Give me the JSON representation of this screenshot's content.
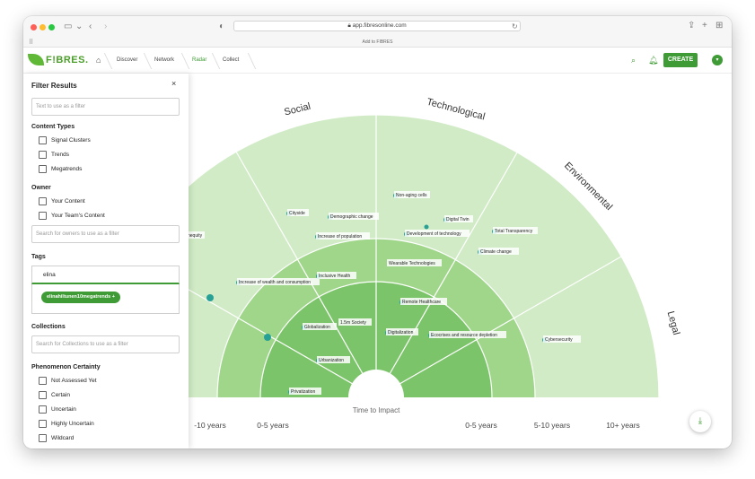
{
  "browser": {
    "url": "app.fibresonline.com",
    "add_to": "Add to FIBRES",
    "lights": [
      "#fe5f57",
      "#febc2e",
      "#28c840"
    ]
  },
  "nav": {
    "logo": "F!BRES.",
    "crumbs": [
      "Discover",
      "Network",
      "Radar",
      "Collect"
    ],
    "active": "Radar",
    "create_label": "CREATE",
    "accent": "#3f9b35"
  },
  "filter": {
    "title": "Filter Results",
    "close": "×",
    "search_placeholder": "Text to use as a filter",
    "content_types_label": "Content Types",
    "content_types": [
      "Signal Clusters",
      "Trends",
      "Megatrends"
    ],
    "owner_label": "Owner",
    "owner_options": [
      "Your Content",
      "Your Team's Content"
    ],
    "owner_placeholder": "Search for owners to use as a filter",
    "tags_label": "Tags",
    "tag_input_value": "elina",
    "tag_chip": "elinahiltunen10megatrends +",
    "collections_label": "Collections",
    "collections_placeholder": "Search for Collections to use as a filter",
    "certainty_label": "Phenomenon Certainty",
    "certainty_options": [
      "Not Assessed Yet",
      "Certain",
      "Uncertain",
      "Highly Uncertain",
      "Wildcard"
    ]
  },
  "radar": {
    "sectors": [
      "Social",
      "Technological",
      "Environmental",
      "Legal"
    ],
    "center_label": "Time to Impact",
    "axis_labels": [
      "-10 years",
      "0-5 years",
      "0-5 years",
      "5-10 years",
      "10+ years"
    ],
    "items": [
      "Non-aging cells",
      "Cityside",
      "Demographic change",
      "Digital Twin",
      "Development of technology",
      "Total Transparency",
      "Increase of population",
      "nequity",
      "Climate change",
      "Wearable Technologies",
      "Increase of wealth and consumption",
      "Inclusive Health",
      "Remote Healthcare",
      "1.5m Society",
      "Globalization",
      "Digitalization",
      "Ecocrises and resource depletion",
      "Cybersecurity",
      "Urbanization",
      "Privatization"
    ],
    "colors": {
      "outer": "#d0ebc5",
      "middle": "#9fd68a",
      "inner": "#7cc46a",
      "dot": "#27a095"
    }
  }
}
